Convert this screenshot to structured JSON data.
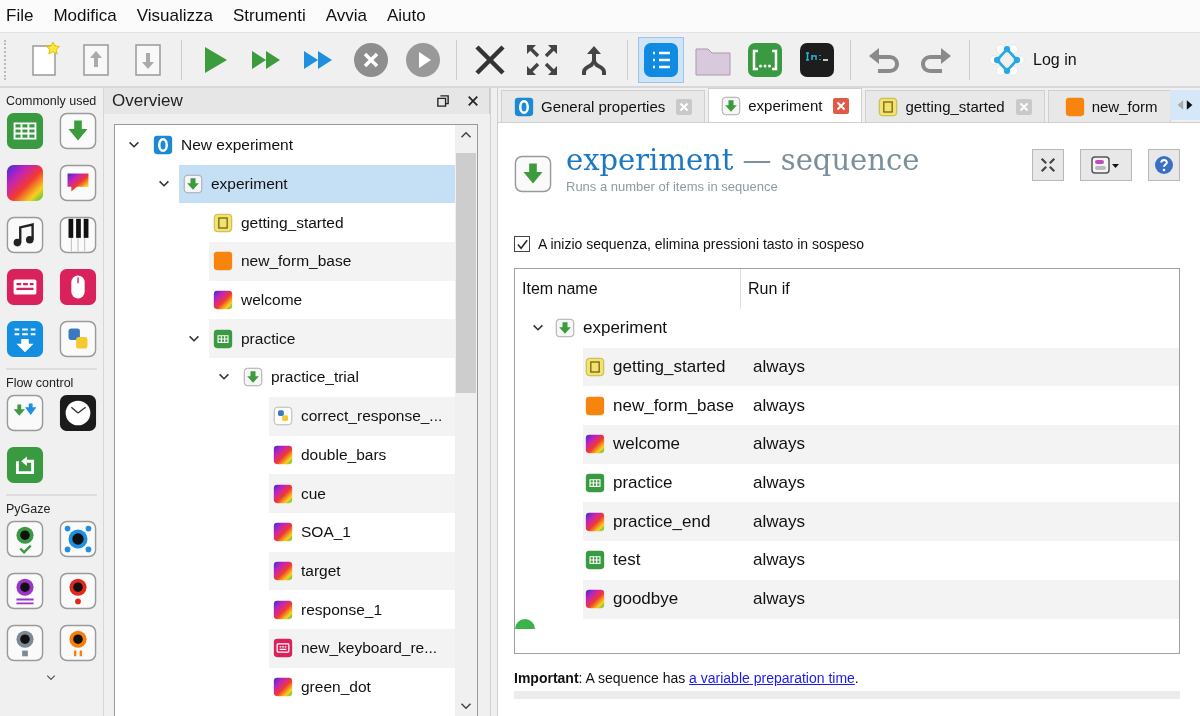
{
  "menu": [
    "File",
    "Modifica",
    "Visualizza",
    "Strumenti",
    "Avvia",
    "Aiuto"
  ],
  "toolbar": {
    "overview_on": true,
    "login_label": "Log in"
  },
  "toolbox": {
    "groups": [
      {
        "label": "Commonly used"
      },
      {
        "label": "Flow control"
      },
      {
        "label": "PyGaze"
      }
    ]
  },
  "overview": {
    "title": "Overview",
    "tree": [
      {
        "label": "New experiment",
        "kind": "general",
        "expanded": true,
        "selected": false,
        "children": [
          {
            "label": "experiment",
            "kind": "sequence",
            "expanded": true,
            "selected": true,
            "children": [
              {
                "label": "getting_started",
                "kind": "notepad",
                "selected": false
              },
              {
                "label": "new_form_base",
                "kind": "form",
                "selected": false
              },
              {
                "label": "welcome",
                "kind": "sketchpad",
                "selected": false
              },
              {
                "label": "practice",
                "kind": "loop",
                "expanded": true,
                "selected": false,
                "children": [
                  {
                    "label": "practice_trial",
                    "kind": "sequence",
                    "expanded": true,
                    "selected": false,
                    "children": [
                      {
                        "label": "correct_response_...",
                        "kind": "inline_script",
                        "selected": false
                      },
                      {
                        "label": "double_bars",
                        "kind": "sketchpad",
                        "selected": false
                      },
                      {
                        "label": "cue",
                        "kind": "sketchpad",
                        "selected": false
                      },
                      {
                        "label": "SOA_1",
                        "kind": "sketchpad",
                        "selected": false
                      },
                      {
                        "label": "target",
                        "kind": "sketchpad",
                        "selected": false
                      },
                      {
                        "label": "response_1",
                        "kind": "sketchpad",
                        "selected": false
                      },
                      {
                        "label": "new_keyboard_re...",
                        "kind": "keyboard",
                        "selected": false
                      },
                      {
                        "label": "green_dot",
                        "kind": "sketchpad",
                        "selected": false
                      }
                    ]
                  }
                ]
              }
            ]
          }
        ]
      }
    ]
  },
  "tabs": [
    {
      "label": "General properties",
      "kind": "general",
      "selected": false
    },
    {
      "label": "experiment",
      "kind": "sequence",
      "selected": true
    },
    {
      "label": "getting_started",
      "kind": "notepad",
      "selected": false
    },
    {
      "label": "new_form",
      "kind": "form",
      "selected": false
    }
  ],
  "editor": {
    "title": "experiment",
    "type_label": "— sequence",
    "description": "Runs a number of items in sequence",
    "flush_keyboard": {
      "label": "A inizio sequenza, elimina pressioni tasto in sospeso",
      "checked": true
    },
    "table": {
      "columns": [
        "Item name",
        "Run if"
      ],
      "rows": [
        {
          "name": "experiment",
          "kind": "sequence",
          "expanded": true,
          "selected": false,
          "children": [
            {
              "name": "getting_started",
              "kind": "notepad",
              "run_if": "always",
              "selected": false
            },
            {
              "name": "new_form_base",
              "kind": "form",
              "run_if": "always",
              "selected": false
            },
            {
              "name": "welcome",
              "kind": "sketchpad",
              "run_if": "always",
              "selected": false
            },
            {
              "name": "practice",
              "kind": "loop",
              "run_if": "always",
              "selected": false
            },
            {
              "name": "practice_end",
              "kind": "sketchpad",
              "run_if": "always",
              "selected": false
            },
            {
              "name": "test",
              "kind": "loop",
              "run_if": "always",
              "selected": false
            },
            {
              "name": "goodbye",
              "kind": "sketchpad",
              "run_if": "always",
              "selected": false
            }
          ]
        }
      ]
    },
    "note": {
      "text": "**Important**: A sequence has ",
      "link": "a variable preparation time",
      "after": "."
    }
  }
}
